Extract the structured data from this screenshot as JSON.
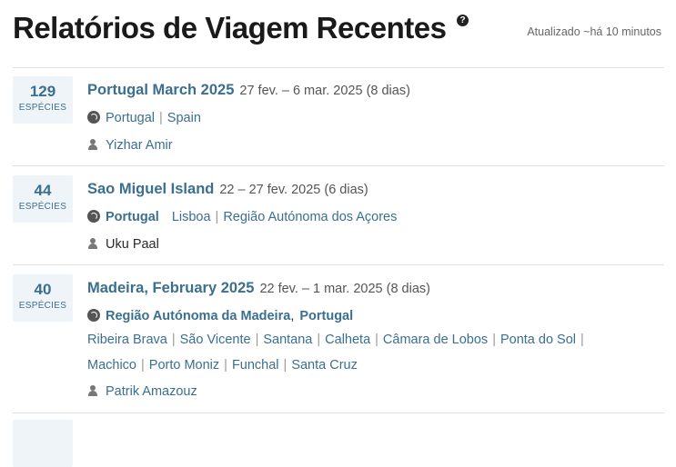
{
  "header": {
    "title": "Relatórios de Viagem Recentes",
    "help_icon": "?",
    "updated": "Atualizado ~há 10 minutos"
  },
  "trips": [
    {
      "species_count": "129",
      "species_label": "ESPÉCIES",
      "title": "Portugal March 2025",
      "dates": "27 fev. – 6 mar. 2025 (8 dias)",
      "locations": [
        "Portugal",
        "Spain"
      ],
      "person": "Yizhar Amir"
    },
    {
      "species_count": "44",
      "species_label": "ESPÉCIES",
      "title": "Sao Miguel Island",
      "dates": "22 – 27 fev. 2025 (6 dias)",
      "country": "Portugal",
      "locations": [
        "Lisboa",
        "Região Autónoma dos Açores"
      ],
      "person": "Uku Paal"
    },
    {
      "species_count": "40",
      "species_label": "ESPÉCIES",
      "title": "Madeira, February 2025",
      "dates": "22 fev. – 1 mar. 2025 (8 dias)",
      "region": "Região Autónoma da Madeira",
      "region_sep": ",",
      "country": "Portugal",
      "locations_line1": [
        "Ribeira Brava",
        "São Vicente",
        "Santana",
        "Calheta",
        "Câmara de Lobos",
        "Ponta do Sol"
      ],
      "locations_line2": [
        "Machico",
        "Porto Moniz",
        "Funchal",
        "Santa Cruz"
      ],
      "person": "Patrik Amazouz"
    }
  ],
  "separator": "|",
  "icons": {
    "location": "globe-icon",
    "observer": "person-icon",
    "help": "question-icon"
  },
  "colors": {
    "link": "#3b6f8f",
    "species_box_bg": "#eef4f7"
  }
}
